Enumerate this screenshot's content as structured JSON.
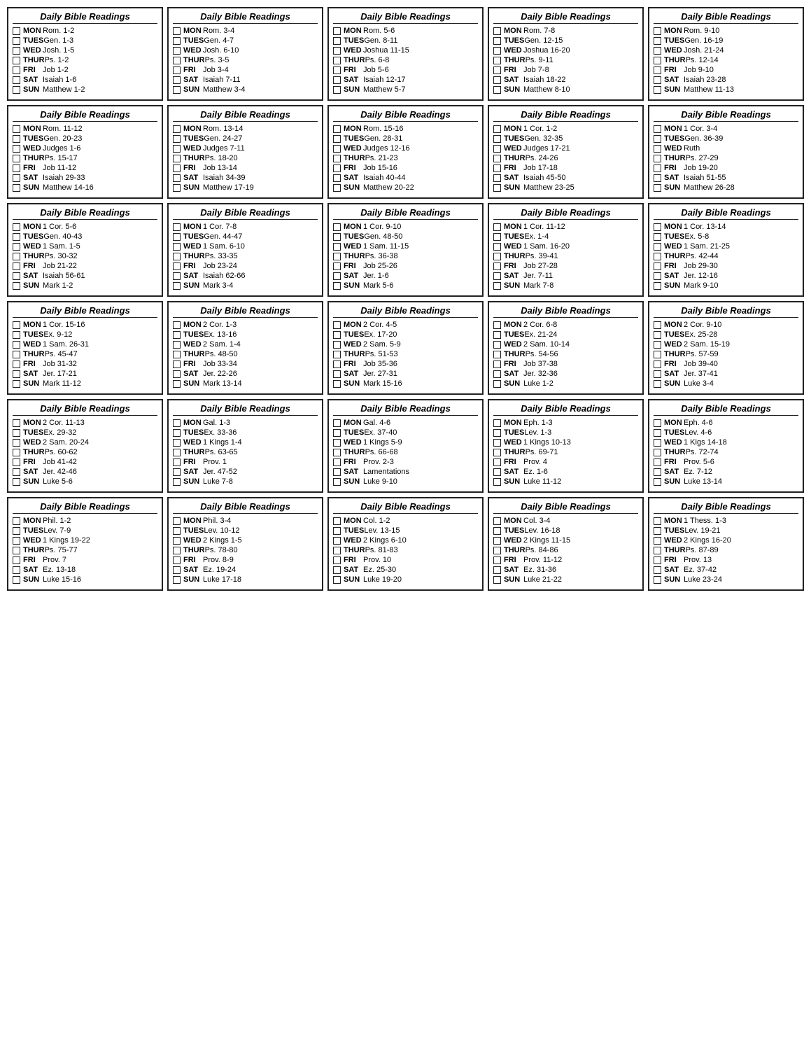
{
  "title": "Daily Bible Readings",
  "cards": [
    {
      "id": 1,
      "readings": [
        {
          "day": "MON",
          "text": "Rom. 1-2"
        },
        {
          "day": "TUES",
          "text": "Gen. 1-3"
        },
        {
          "day": "WED",
          "text": "Josh. 1-5"
        },
        {
          "day": "THUR",
          "text": "Ps. 1-2"
        },
        {
          "day": "FRI",
          "text": "Job 1-2"
        },
        {
          "day": "SAT",
          "text": "Isaiah 1-6"
        },
        {
          "day": "SUN",
          "text": "Matthew 1-2"
        }
      ]
    },
    {
      "id": 2,
      "readings": [
        {
          "day": "MON",
          "text": "Rom. 3-4"
        },
        {
          "day": "TUES",
          "text": "Gen. 4-7"
        },
        {
          "day": "WED",
          "text": "Josh. 6-10"
        },
        {
          "day": "THUR",
          "text": "Ps. 3-5"
        },
        {
          "day": "FRI",
          "text": "Job 3-4"
        },
        {
          "day": "SAT",
          "text": "Isaiah 7-11"
        },
        {
          "day": "SUN",
          "text": "Matthew 3-4"
        }
      ]
    },
    {
      "id": 3,
      "readings": [
        {
          "day": "MON",
          "text": "Rom. 5-6"
        },
        {
          "day": "TUES",
          "text": "Gen. 8-11"
        },
        {
          "day": "WED",
          "text": "Joshua 11-15"
        },
        {
          "day": "THUR",
          "text": "Ps. 6-8"
        },
        {
          "day": "FRI",
          "text": "Job 5-6"
        },
        {
          "day": "SAT",
          "text": "Isaiah 12-17"
        },
        {
          "day": "SUN",
          "text": "Matthew 5-7"
        }
      ]
    },
    {
      "id": 4,
      "readings": [
        {
          "day": "MON",
          "text": "Rom. 7-8"
        },
        {
          "day": "TUES",
          "text": "Gen. 12-15"
        },
        {
          "day": "WED",
          "text": "Joshua 16-20"
        },
        {
          "day": "THUR",
          "text": "Ps. 9-11"
        },
        {
          "day": "FRI",
          "text": "Job 7-8"
        },
        {
          "day": "SAT",
          "text": "Isaiah 18-22"
        },
        {
          "day": "SUN",
          "text": "Matthew 8-10"
        }
      ]
    },
    {
      "id": 5,
      "readings": [
        {
          "day": "MON",
          "text": "Rom. 9-10"
        },
        {
          "day": "TUES",
          "text": "Gen. 16-19"
        },
        {
          "day": "WED",
          "text": "Josh. 21-24"
        },
        {
          "day": "THUR",
          "text": "Ps. 12-14"
        },
        {
          "day": "FRI",
          "text": "Job 9-10"
        },
        {
          "day": "SAT",
          "text": "Isaiah 23-28"
        },
        {
          "day": "SUN",
          "text": "Matthew 11-13"
        }
      ]
    },
    {
      "id": 6,
      "readings": [
        {
          "day": "MON",
          "text": "Rom. 11-12"
        },
        {
          "day": "TUES",
          "text": "Gen. 20-23"
        },
        {
          "day": "WED",
          "text": "Judges 1-6"
        },
        {
          "day": "THUR",
          "text": "Ps. 15-17"
        },
        {
          "day": "FRI",
          "text": "Job 11-12"
        },
        {
          "day": "SAT",
          "text": "Isaiah 29-33"
        },
        {
          "day": "SUN",
          "text": "Matthew 14-16"
        }
      ]
    },
    {
      "id": 7,
      "readings": [
        {
          "day": "MON",
          "text": "Rom. 13-14"
        },
        {
          "day": "TUES",
          "text": "Gen. 24-27"
        },
        {
          "day": "WED",
          "text": "Judges 7-11"
        },
        {
          "day": "THUR",
          "text": "Ps. 18-20"
        },
        {
          "day": "FRI",
          "text": "Job 13-14"
        },
        {
          "day": "SAT",
          "text": "Isaiah 34-39"
        },
        {
          "day": "SUN",
          "text": "Matthew 17-19"
        }
      ]
    },
    {
      "id": 8,
      "readings": [
        {
          "day": "MON",
          "text": "Rom. 15-16"
        },
        {
          "day": "TUES",
          "text": "Gen. 28-31"
        },
        {
          "day": "WED",
          "text": "Judges 12-16"
        },
        {
          "day": "THUR",
          "text": "Ps. 21-23"
        },
        {
          "day": "FRI",
          "text": "Job 15-16"
        },
        {
          "day": "SAT",
          "text": "Isaiah 40-44"
        },
        {
          "day": "SUN",
          "text": "Matthew 20-22"
        }
      ]
    },
    {
      "id": 9,
      "readings": [
        {
          "day": "MON",
          "text": "1 Cor. 1-2"
        },
        {
          "day": "TUES",
          "text": "Gen. 32-35"
        },
        {
          "day": "WED",
          "text": "Judges 17-21"
        },
        {
          "day": "THUR",
          "text": "Ps. 24-26"
        },
        {
          "day": "FRI",
          "text": "Job 17-18"
        },
        {
          "day": "SAT",
          "text": "Isaiah 45-50"
        },
        {
          "day": "SUN",
          "text": "Matthew 23-25"
        }
      ]
    },
    {
      "id": 10,
      "readings": [
        {
          "day": "MON",
          "text": "1 Cor. 3-4"
        },
        {
          "day": "TUES",
          "text": "Gen. 36-39"
        },
        {
          "day": "WED",
          "text": "Ruth"
        },
        {
          "day": "THUR",
          "text": "Ps. 27-29"
        },
        {
          "day": "FRI",
          "text": "Job 19-20"
        },
        {
          "day": "SAT",
          "text": "Isaiah 51-55"
        },
        {
          "day": "SUN",
          "text": "Matthew 26-28"
        }
      ]
    },
    {
      "id": 11,
      "readings": [
        {
          "day": "MON",
          "text": "1 Cor. 5-6"
        },
        {
          "day": "TUES",
          "text": "Gen. 40-43"
        },
        {
          "day": "WED",
          "text": "1 Sam. 1-5"
        },
        {
          "day": "THUR",
          "text": "Ps. 30-32"
        },
        {
          "day": "FRI",
          "text": "Job 21-22"
        },
        {
          "day": "SAT",
          "text": "Isaiah 56-61"
        },
        {
          "day": "SUN",
          "text": "Mark 1-2"
        }
      ]
    },
    {
      "id": 12,
      "readings": [
        {
          "day": "MON",
          "text": "1 Cor. 7-8"
        },
        {
          "day": "TUES",
          "text": "Gen. 44-47"
        },
        {
          "day": "WED",
          "text": "1 Sam. 6-10"
        },
        {
          "day": "THUR",
          "text": "Ps. 33-35"
        },
        {
          "day": "FRI",
          "text": "Job 23-24"
        },
        {
          "day": "SAT",
          "text": "Isaiah 62-66"
        },
        {
          "day": "SUN",
          "text": "Mark 3-4"
        }
      ]
    },
    {
      "id": 13,
      "readings": [
        {
          "day": "MON",
          "text": "1 Cor. 9-10"
        },
        {
          "day": "TUES",
          "text": "Gen. 48-50"
        },
        {
          "day": "WED",
          "text": "1 Sam. 11-15"
        },
        {
          "day": "THUR",
          "text": "Ps. 36-38"
        },
        {
          "day": "FRI",
          "text": "Job 25-26"
        },
        {
          "day": "SAT",
          "text": "Jer. 1-6"
        },
        {
          "day": "SUN",
          "text": "Mark 5-6"
        }
      ]
    },
    {
      "id": 14,
      "readings": [
        {
          "day": "MON",
          "text": "1 Cor. 11-12"
        },
        {
          "day": "TUES",
          "text": "Ex. 1-4"
        },
        {
          "day": "WED",
          "text": "1 Sam. 16-20"
        },
        {
          "day": "THUR",
          "text": "Ps. 39-41"
        },
        {
          "day": "FRI",
          "text": "Job 27-28"
        },
        {
          "day": "SAT",
          "text": "Jer. 7-11"
        },
        {
          "day": "SUN",
          "text": "Mark 7-8"
        }
      ]
    },
    {
      "id": 15,
      "readings": [
        {
          "day": "MON",
          "text": "1 Cor. 13-14"
        },
        {
          "day": "TUES",
          "text": "Ex. 5-8"
        },
        {
          "day": "WED",
          "text": "1 Sam. 21-25"
        },
        {
          "day": "THUR",
          "text": "Ps. 42-44"
        },
        {
          "day": "FRI",
          "text": "Job 29-30"
        },
        {
          "day": "SAT",
          "text": "Jer. 12-16"
        },
        {
          "day": "SUN",
          "text": "Mark 9-10"
        }
      ]
    },
    {
      "id": 16,
      "readings": [
        {
          "day": "MON",
          "text": "1 Cor. 15-16"
        },
        {
          "day": "TUES",
          "text": "Ex. 9-12"
        },
        {
          "day": "WED",
          "text": "1 Sam. 26-31"
        },
        {
          "day": "THUR",
          "text": "Ps. 45-47"
        },
        {
          "day": "FRI",
          "text": "Job 31-32"
        },
        {
          "day": "SAT",
          "text": "Jer. 17-21"
        },
        {
          "day": "SUN",
          "text": "Mark 11-12"
        }
      ]
    },
    {
      "id": 17,
      "readings": [
        {
          "day": "MON",
          "text": "2 Cor. 1-3"
        },
        {
          "day": "TUES",
          "text": "Ex. 13-16"
        },
        {
          "day": "WED",
          "text": "2 Sam. 1-4"
        },
        {
          "day": "THUR",
          "text": "Ps. 48-50"
        },
        {
          "day": "FRI",
          "text": "Job 33-34"
        },
        {
          "day": "SAT",
          "text": "Jer. 22-26"
        },
        {
          "day": "SUN",
          "text": "Mark 13-14"
        }
      ]
    },
    {
      "id": 18,
      "readings": [
        {
          "day": "MON",
          "text": "2 Cor. 4-5"
        },
        {
          "day": "TUES",
          "text": "Ex. 17-20"
        },
        {
          "day": "WED",
          "text": "2 Sam. 5-9"
        },
        {
          "day": "THUR",
          "text": "Ps. 51-53"
        },
        {
          "day": "FRI",
          "text": "Job 35-36"
        },
        {
          "day": "SAT",
          "text": "Jer. 27-31"
        },
        {
          "day": "SUN",
          "text": "Mark 15-16"
        }
      ]
    },
    {
      "id": 19,
      "readings": [
        {
          "day": "MON",
          "text": "2 Cor. 6-8"
        },
        {
          "day": "TUES",
          "text": "Ex. 21-24"
        },
        {
          "day": "WED",
          "text": "2 Sam. 10-14"
        },
        {
          "day": "THUR",
          "text": "Ps. 54-56"
        },
        {
          "day": "FRI",
          "text": "Job 37-38"
        },
        {
          "day": "SAT",
          "text": "Jer. 32-36"
        },
        {
          "day": "SUN",
          "text": "Luke 1-2"
        }
      ]
    },
    {
      "id": 20,
      "readings": [
        {
          "day": "MON",
          "text": "2 Cor. 9-10"
        },
        {
          "day": "TUES",
          "text": "Ex. 25-28"
        },
        {
          "day": "WED",
          "text": "2 Sam. 15-19"
        },
        {
          "day": "THUR",
          "text": "Ps. 57-59"
        },
        {
          "day": "FRI",
          "text": "Job 39-40"
        },
        {
          "day": "SAT",
          "text": "Jer. 37-41"
        },
        {
          "day": "SUN",
          "text": "Luke 3-4"
        }
      ]
    },
    {
      "id": 21,
      "readings": [
        {
          "day": "MON",
          "text": "2 Cor. 11-13"
        },
        {
          "day": "TUES",
          "text": "Ex. 29-32"
        },
        {
          "day": "WED",
          "text": "2 Sam. 20-24"
        },
        {
          "day": "THUR",
          "text": "Ps. 60-62"
        },
        {
          "day": "FRI",
          "text": "Job 41-42"
        },
        {
          "day": "SAT",
          "text": "Jer. 42-46"
        },
        {
          "day": "SUN",
          "text": "Luke 5-6"
        }
      ]
    },
    {
      "id": 22,
      "readings": [
        {
          "day": "MON",
          "text": "Gal. 1-3"
        },
        {
          "day": "TUES",
          "text": "Ex. 33-36"
        },
        {
          "day": "WED",
          "text": "1 Kings 1-4"
        },
        {
          "day": "THUR",
          "text": "Ps. 63-65"
        },
        {
          "day": "FRI",
          "text": "Prov. 1"
        },
        {
          "day": "SAT",
          "text": "Jer. 47-52"
        },
        {
          "day": "SUN",
          "text": "Luke 7-8"
        }
      ]
    },
    {
      "id": 23,
      "readings": [
        {
          "day": "MON",
          "text": "Gal. 4-6"
        },
        {
          "day": "TUES",
          "text": "Ex. 37-40"
        },
        {
          "day": "WED",
          "text": "1 Kings 5-9"
        },
        {
          "day": "THUR",
          "text": "Ps. 66-68"
        },
        {
          "day": "FRI",
          "text": "Prov. 2-3"
        },
        {
          "day": "SAT",
          "text": "Lamentations"
        },
        {
          "day": "SUN",
          "text": "Luke 9-10"
        }
      ]
    },
    {
      "id": 24,
      "readings": [
        {
          "day": "MON",
          "text": "Eph. 1-3"
        },
        {
          "day": "TUES",
          "text": "Lev. 1-3"
        },
        {
          "day": "WED",
          "text": "1 Kings 10-13"
        },
        {
          "day": "THUR",
          "text": "Ps. 69-71"
        },
        {
          "day": "FRI",
          "text": "Prov. 4"
        },
        {
          "day": "SAT",
          "text": "Ez. 1-6"
        },
        {
          "day": "SUN",
          "text": "Luke 11-12"
        }
      ]
    },
    {
      "id": 25,
      "readings": [
        {
          "day": "MON",
          "text": "Eph. 4-6"
        },
        {
          "day": "TUES",
          "text": "Lev. 4-6"
        },
        {
          "day": "WED",
          "text": "1 Kigs 14-18"
        },
        {
          "day": "THUR",
          "text": "Ps. 72-74"
        },
        {
          "day": "FRI",
          "text": "Prov. 5-6"
        },
        {
          "day": "SAT",
          "text": "Ez. 7-12"
        },
        {
          "day": "SUN",
          "text": "Luke 13-14"
        }
      ]
    },
    {
      "id": 26,
      "readings": [
        {
          "day": "MON",
          "text": "Phil. 1-2"
        },
        {
          "day": "TUES",
          "text": "Lev. 7-9"
        },
        {
          "day": "WED",
          "text": "1 Kings 19-22"
        },
        {
          "day": "THUR",
          "text": "Ps. 75-77"
        },
        {
          "day": "FRI",
          "text": "Prov. 7"
        },
        {
          "day": "SAT",
          "text": "Ez. 13-18"
        },
        {
          "day": "SUN",
          "text": "Luke 15-16"
        }
      ]
    },
    {
      "id": 27,
      "readings": [
        {
          "day": "MON",
          "text": "Phil. 3-4"
        },
        {
          "day": "TUES",
          "text": "Lev. 10-12"
        },
        {
          "day": "WED",
          "text": "2 Kings 1-5"
        },
        {
          "day": "THUR",
          "text": "Ps. 78-80"
        },
        {
          "day": "FRI",
          "text": "Prov. 8-9"
        },
        {
          "day": "SAT",
          "text": "Ez. 19-24"
        },
        {
          "day": "SUN",
          "text": "Luke 17-18"
        }
      ]
    },
    {
      "id": 28,
      "readings": [
        {
          "day": "MON",
          "text": "Col. 1-2"
        },
        {
          "day": "TUES",
          "text": "Lev. 13-15"
        },
        {
          "day": "WED",
          "text": "2 Kings 6-10"
        },
        {
          "day": "THUR",
          "text": "Ps. 81-83"
        },
        {
          "day": "FRI",
          "text": "Prov. 10"
        },
        {
          "day": "SAT",
          "text": "Ez. 25-30"
        },
        {
          "day": "SUN",
          "text": "Luke 19-20"
        }
      ]
    },
    {
      "id": 29,
      "readings": [
        {
          "day": "MON",
          "text": "Col. 3-4"
        },
        {
          "day": "TUES",
          "text": "Lev. 16-18"
        },
        {
          "day": "WED",
          "text": "2 Kings 11-15"
        },
        {
          "day": "THUR",
          "text": "Ps. 84-86"
        },
        {
          "day": "FRI",
          "text": "Prov. 11-12"
        },
        {
          "day": "SAT",
          "text": "Ez. 31-36"
        },
        {
          "day": "SUN",
          "text": "Luke 21-22"
        }
      ]
    },
    {
      "id": 30,
      "readings": [
        {
          "day": "MON",
          "text": "1 Thess. 1-3"
        },
        {
          "day": "TUES",
          "text": "Lev. 19-21"
        },
        {
          "day": "WED",
          "text": "2 Kings 16-20"
        },
        {
          "day": "THUR",
          "text": "Ps. 87-89"
        },
        {
          "day": "FRI",
          "text": "Prov. 13"
        },
        {
          "day": "SAT",
          "text": "Ez. 37-42"
        },
        {
          "day": "SUN",
          "text": "Luke 23-24"
        }
      ]
    }
  ]
}
